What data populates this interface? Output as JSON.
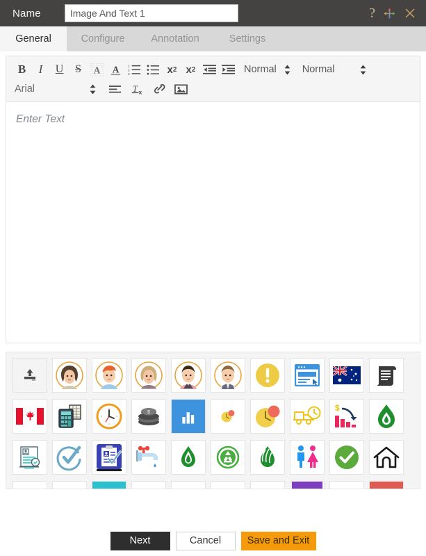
{
  "header": {
    "name_label": "Name",
    "name_value": "Image And Text 1",
    "name_placeholder": "Image And Text 1",
    "help_icon": "question-mark-icon",
    "move_icon": "move-arrows-icon",
    "close_icon": "close-x-icon",
    "bg_color": "#444342"
  },
  "tabs": [
    {
      "label": "General",
      "active": true
    },
    {
      "label": "Configure",
      "active": false
    },
    {
      "label": "Annotation",
      "active": false
    },
    {
      "label": "Settings",
      "active": false
    }
  ],
  "toolbar": {
    "row1": [
      {
        "name": "bold-icon",
        "label": "B"
      },
      {
        "name": "italic-icon",
        "label": "I"
      },
      {
        "name": "underline-icon",
        "label": "U"
      },
      {
        "name": "strikethrough-icon",
        "label": "S"
      },
      {
        "name": "highlight-color-icon",
        "label": "A"
      },
      {
        "name": "text-color-icon",
        "label": "A"
      },
      {
        "name": "ordered-list-icon",
        "label": ""
      },
      {
        "name": "unordered-list-icon",
        "label": ""
      },
      {
        "name": "subscript-icon",
        "label": "x"
      },
      {
        "name": "superscript-icon",
        "label": "x"
      },
      {
        "name": "outdent-icon",
        "label": ""
      },
      {
        "name": "indent-icon",
        "label": ""
      }
    ],
    "heading_select": "Normal",
    "size_select": "Normal",
    "font_select": "Arial",
    "row2": [
      {
        "name": "align-icon",
        "label": ""
      },
      {
        "name": "clear-formatting-icon",
        "label": ""
      },
      {
        "name": "insert-link-icon",
        "label": ""
      },
      {
        "name": "insert-image-icon",
        "label": ""
      }
    ]
  },
  "editor": {
    "placeholder": "Enter Text"
  },
  "icon_grid": {
    "columns": 10,
    "cells": [
      {
        "name": "upload-icon",
        "plain": true
      },
      {
        "name": "avatar-woman-brown-hair-icon"
      },
      {
        "name": "avatar-man-red-hair-icon"
      },
      {
        "name": "avatar-woman-blonde-icon"
      },
      {
        "name": "avatar-man-dark-hair-icon"
      },
      {
        "name": "avatar-man-suit-icon"
      },
      {
        "name": "warning-exclamation-icon"
      },
      {
        "name": "browser-window-icon"
      },
      {
        "name": "australia-flag-icon"
      },
      {
        "name": "scroll-document-icon"
      },
      {
        "name": "canada-flag-icon"
      },
      {
        "name": "calculator-icon"
      },
      {
        "name": "clock-icon"
      },
      {
        "name": "coins-stack-icon"
      },
      {
        "name": "bar-chart-tile-icon"
      },
      {
        "name": "small-clock-dot-icon"
      },
      {
        "name": "clock-alert-icon"
      },
      {
        "name": "delivery-truck-time-icon"
      },
      {
        "name": "cost-reduction-chart-icon"
      },
      {
        "name": "green-flame-icon"
      },
      {
        "name": "document-verify-icon"
      },
      {
        "name": "check-circle-outline-icon"
      },
      {
        "name": "clipboard-check-icon"
      },
      {
        "name": "water-tap-icon"
      },
      {
        "name": "green-flame-leaf-icon"
      },
      {
        "name": "recycle-circle-icon"
      },
      {
        "name": "flame-leaves-icon"
      },
      {
        "name": "restroom-signs-icon"
      },
      {
        "name": "green-check-circle-icon"
      },
      {
        "name": "home-outline-icon"
      },
      {
        "name": "orange-arc-icon",
        "clipped": true
      },
      {
        "name": "orange-dome-icon",
        "clipped": true
      },
      {
        "name": "teal-bar-icon",
        "clipped": true
      },
      {
        "name": "blue-shape-icon",
        "clipped": true
      },
      {
        "name": "dark-square-icon",
        "clipped": true
      },
      {
        "name": "navy-circle-icon",
        "clipped": true
      },
      {
        "name": "navy-arc-icon",
        "clipped": true
      },
      {
        "name": "purple-bar-icon",
        "clipped": true
      },
      {
        "name": "blue-flag-icon",
        "clipped": true
      },
      {
        "name": "red-bar-icon",
        "clipped": true
      }
    ]
  },
  "footer": {
    "next_label": "Next",
    "cancel_label": "Cancel",
    "save_label": "Save and Exit",
    "save_color": "#f59b0b",
    "next_color": "#2e2e2e"
  }
}
